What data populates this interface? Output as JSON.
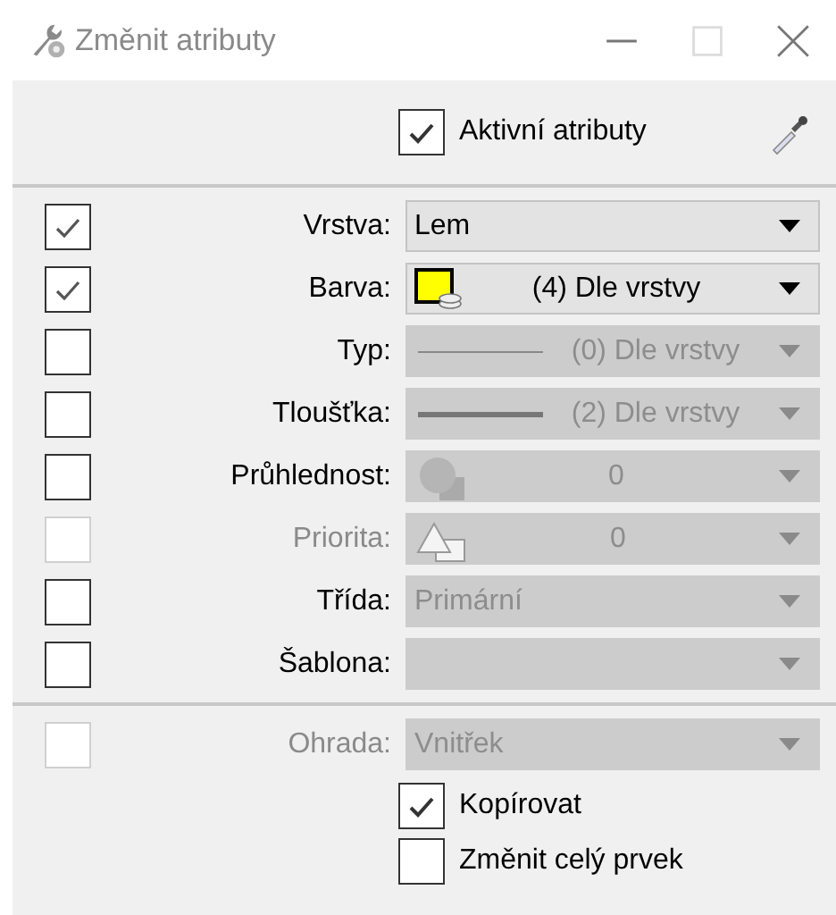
{
  "window": {
    "title": "Změnit atributy"
  },
  "active_attributes": {
    "label": "Aktivní atributy",
    "checked": true
  },
  "rows": [
    {
      "label": "Vrstva:",
      "checked": true,
      "disabled": false,
      "field_disabled": false,
      "value": "Lem",
      "kind": "text"
    },
    {
      "label": "Barva:",
      "checked": true,
      "disabled": false,
      "field_disabled": false,
      "value": "(4) Dle vrstvy",
      "kind": "color",
      "color": "#ffff00"
    },
    {
      "label": "Typ:",
      "checked": false,
      "disabled": false,
      "field_disabled": true,
      "value": "(0) Dle vrstvy",
      "kind": "thin-line"
    },
    {
      "label": "Tloušťka:",
      "checked": false,
      "disabled": false,
      "field_disabled": true,
      "value": "(2) Dle vrstvy",
      "kind": "thick-line"
    },
    {
      "label": "Průhlednost:",
      "checked": false,
      "disabled": false,
      "field_disabled": true,
      "value": "0",
      "kind": "transparency"
    },
    {
      "label": "Priorita:",
      "checked": false,
      "disabled": true,
      "field_disabled": true,
      "value": "0",
      "kind": "priority"
    },
    {
      "label": "Třída:",
      "checked": false,
      "disabled": false,
      "field_disabled": true,
      "value": "Primární",
      "kind": "text"
    },
    {
      "label": "Šablona:",
      "checked": false,
      "disabled": false,
      "field_disabled": true,
      "kind": "text"
    }
  ],
  "footer_rows": [
    {
      "label": "Ohrada:",
      "checked": false,
      "disabled": true,
      "field_disabled": true,
      "value": "Vnitřek",
      "kind": "text"
    }
  ],
  "options": [
    {
      "label": "Kopírovat",
      "checked": true
    },
    {
      "label": "Změnit celý prvek",
      "checked": false
    }
  ]
}
